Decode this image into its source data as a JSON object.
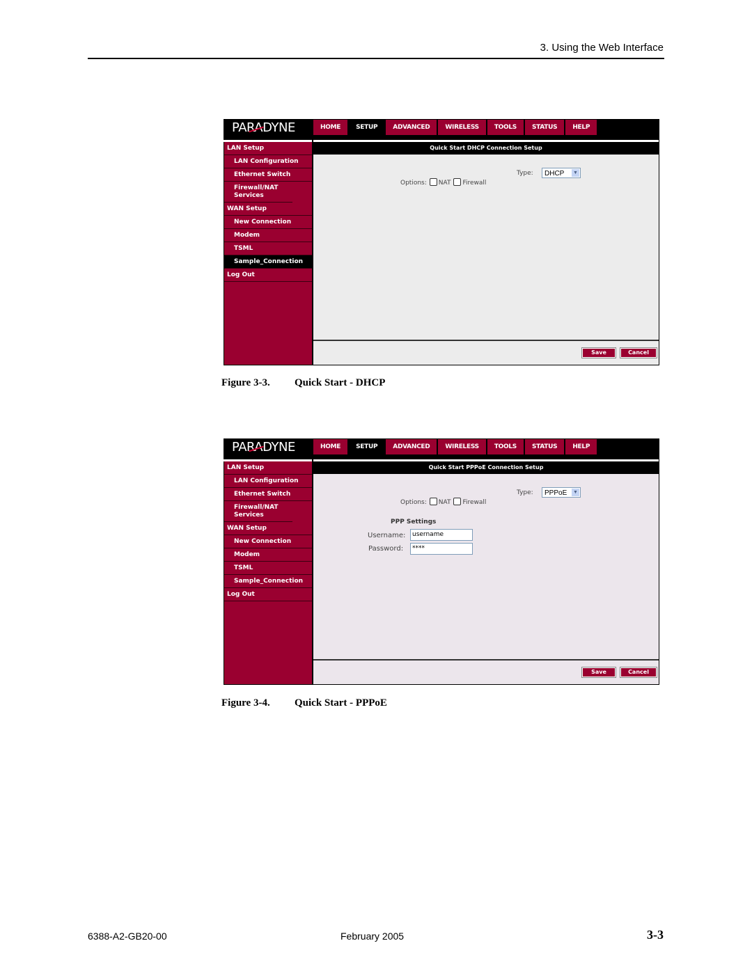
{
  "header": {
    "running_head": "3. Using the Web Interface"
  },
  "figures": [
    {
      "caption_num": "Figure 3-3.",
      "caption_title": "Quick Start - DHCP",
      "app": {
        "logo": "PARADYNE",
        "nav": [
          "HOME",
          "SETUP",
          "ADVANCED",
          "WIRELESS",
          "TOOLS",
          "STATUS",
          "HELP"
        ],
        "active_nav": "SETUP",
        "sidebar": [
          {
            "label": "LAN Setup",
            "sub": false
          },
          {
            "label": "LAN Configuration",
            "sub": true
          },
          {
            "label": "Ethernet Switch",
            "sub": true
          },
          {
            "label": "Firewall/NAT Services",
            "sub": true
          },
          {
            "label": "WAN Setup",
            "sub": false
          },
          {
            "label": "New Connection",
            "sub": true
          },
          {
            "label": "Modem",
            "sub": true
          },
          {
            "label": "TSML",
            "sub": true
          },
          {
            "label": "Sample_Connection",
            "sub": true,
            "selected": true
          },
          {
            "label": "Log Out",
            "sub": false
          }
        ],
        "content_title": "Quick Start DHCP Connection Setup",
        "type_label": "Type:",
        "type_value": "DHCP",
        "options_label": "Options:",
        "nat_label": "NAT",
        "firewall_label": "Firewall",
        "save_label": "Save",
        "cancel_label": "Cancel"
      }
    },
    {
      "caption_num": "Figure 3-4.",
      "caption_title": "Quick Start - PPPoE",
      "app": {
        "logo": "PARADYNE",
        "nav": [
          "HOME",
          "SETUP",
          "ADVANCED",
          "WIRELESS",
          "TOOLS",
          "STATUS",
          "HELP"
        ],
        "active_nav": "SETUP",
        "sidebar": [
          {
            "label": "LAN Setup",
            "sub": false
          },
          {
            "label": "LAN Configuration",
            "sub": true
          },
          {
            "label": "Ethernet Switch",
            "sub": true
          },
          {
            "label": "Firewall/NAT Services",
            "sub": true
          },
          {
            "label": "WAN Setup",
            "sub": false
          },
          {
            "label": "New Connection",
            "sub": true
          },
          {
            "label": "Modem",
            "sub": true
          },
          {
            "label": "TSML",
            "sub": true
          },
          {
            "label": "Sample_Connection",
            "sub": true
          },
          {
            "label": "Log Out",
            "sub": false
          }
        ],
        "content_title": "Quick Start PPPoE Connection Setup",
        "type_label": "Type:",
        "type_value": "PPPoE",
        "options_label": "Options:",
        "nat_label": "NAT",
        "firewall_label": "Firewall",
        "ppp_heading": "PPP Settings",
        "username_label": "Username:",
        "username_value": "username",
        "password_label": "Password:",
        "password_value": "****",
        "save_label": "Save",
        "cancel_label": "Cancel"
      }
    }
  ],
  "footer": {
    "doc_number": "6388-A2-GB20-00",
    "date": "February 2005",
    "page": "3-3"
  },
  "colors": {
    "brand": "#9a0030",
    "bar": "#000000"
  }
}
